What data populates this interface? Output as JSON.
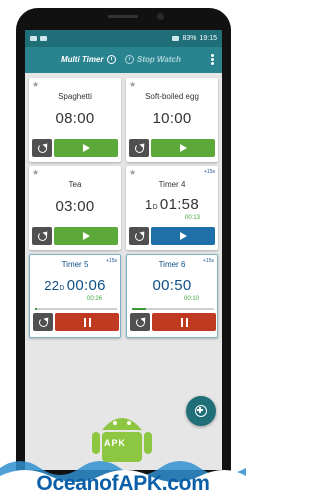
{
  "status_bar": {
    "signal": "83%",
    "time": "19:15"
  },
  "appbar": {
    "tabs": [
      {
        "label": "Multi Timer",
        "active": true
      },
      {
        "label": "Stop Watch",
        "active": false
      }
    ]
  },
  "timers": [
    {
      "name": "Spaghetti",
      "time": "08:00",
      "action": "play",
      "action_color": "#5ca93a",
      "state": "idle"
    },
    {
      "name": "Soft-boiled egg",
      "time": "10:00",
      "action": "play",
      "action_color": "#5ca93a",
      "state": "idle"
    },
    {
      "name": "Tea",
      "time": "03:00",
      "action": "play",
      "action_color": "#5ca93a",
      "state": "idle"
    },
    {
      "name": "Timer 4",
      "plus_label": "+15s",
      "days": "1",
      "days_unit": "D",
      "time": "01:58",
      "elapsed": "00:13",
      "action": "play",
      "action_color": "#1f70a8",
      "state": "paused"
    },
    {
      "name": "Timer 5",
      "plus_label": "+15s",
      "days": "22",
      "days_unit": "D",
      "time": "00:06",
      "elapsed": "00:26",
      "action": "pause",
      "action_color": "#c03a22",
      "state": "running",
      "progress": 0.02
    },
    {
      "name": "Timer 6",
      "plus_label": "+15s",
      "time": "00:50",
      "elapsed": "00:10",
      "action": "pause",
      "action_color": "#c03a22",
      "state": "running",
      "progress": 0.17
    }
  ],
  "fab": {
    "icon": "add-timer-icon"
  },
  "watermark": {
    "text": "OceanofAPK.com",
    "badge": "APK"
  },
  "colors": {
    "primary": "#2a8490",
    "status": "#1f6e78",
    "accent_blue": "#0f4f86",
    "green": "#5ca93a",
    "red": "#c03a22"
  }
}
